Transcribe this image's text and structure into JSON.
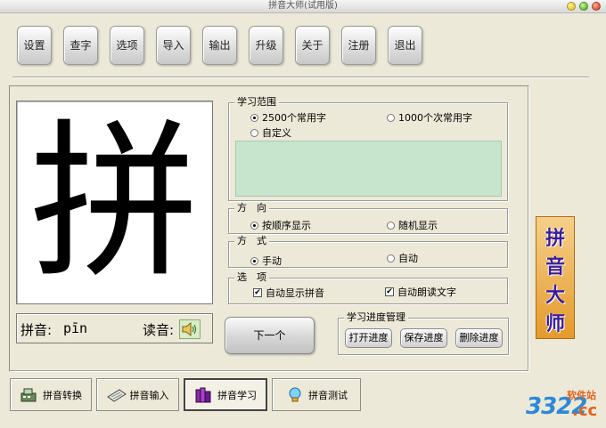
{
  "window": {
    "title": "拼音大师(试用版)"
  },
  "toolbar": {
    "buttons": [
      "设置",
      "查字",
      "选项",
      "导入",
      "输出",
      "升级",
      "关于",
      "注册",
      "退出"
    ]
  },
  "display": {
    "character": "拼",
    "pinyin_label": "拼音:",
    "pinyin_value": "pīn",
    "read_label": "读音:"
  },
  "scope": {
    "title": "学习范围",
    "opt1": "2500个常用字",
    "opt2": "1000个次常用字",
    "opt3": "自定义",
    "selected": "2500个常用字"
  },
  "direction": {
    "title": "方　向",
    "opt1": "按顺序显示",
    "opt2": "随机显示",
    "selected": "按顺序显示"
  },
  "mode": {
    "title": "方　式",
    "opt1": "手动",
    "opt2": "自动",
    "selected": "手动"
  },
  "options": {
    "title": "选　项",
    "check1": "自动显示拼音",
    "check2": "自动朗读文字",
    "check1_on": true,
    "check2_on": true
  },
  "next_button": "下一个",
  "progress": {
    "title": "学习进度管理",
    "open": "打开进度",
    "save": "保存进度",
    "delete": "删除进度"
  },
  "logo": {
    "chars": [
      "拼",
      "音",
      "大",
      "师"
    ]
  },
  "tabs": [
    {
      "label": "拼音转换",
      "icon": "convert-icon"
    },
    {
      "label": "拼音输入",
      "icon": "keyboard-icon"
    },
    {
      "label": "拼音学习",
      "icon": "books-icon",
      "active": true
    },
    {
      "label": "拼音测试",
      "icon": "lightbulb-icon"
    }
  ],
  "watermark": {
    "number": "3322",
    "site": "软件站",
    "domain": ".cc"
  },
  "colors": {
    "window_bg": "#ECE9D8",
    "list_bg": "#C7E5CD",
    "logo_text": "#3a1d9a",
    "logo_bg": "#e49a2c"
  }
}
